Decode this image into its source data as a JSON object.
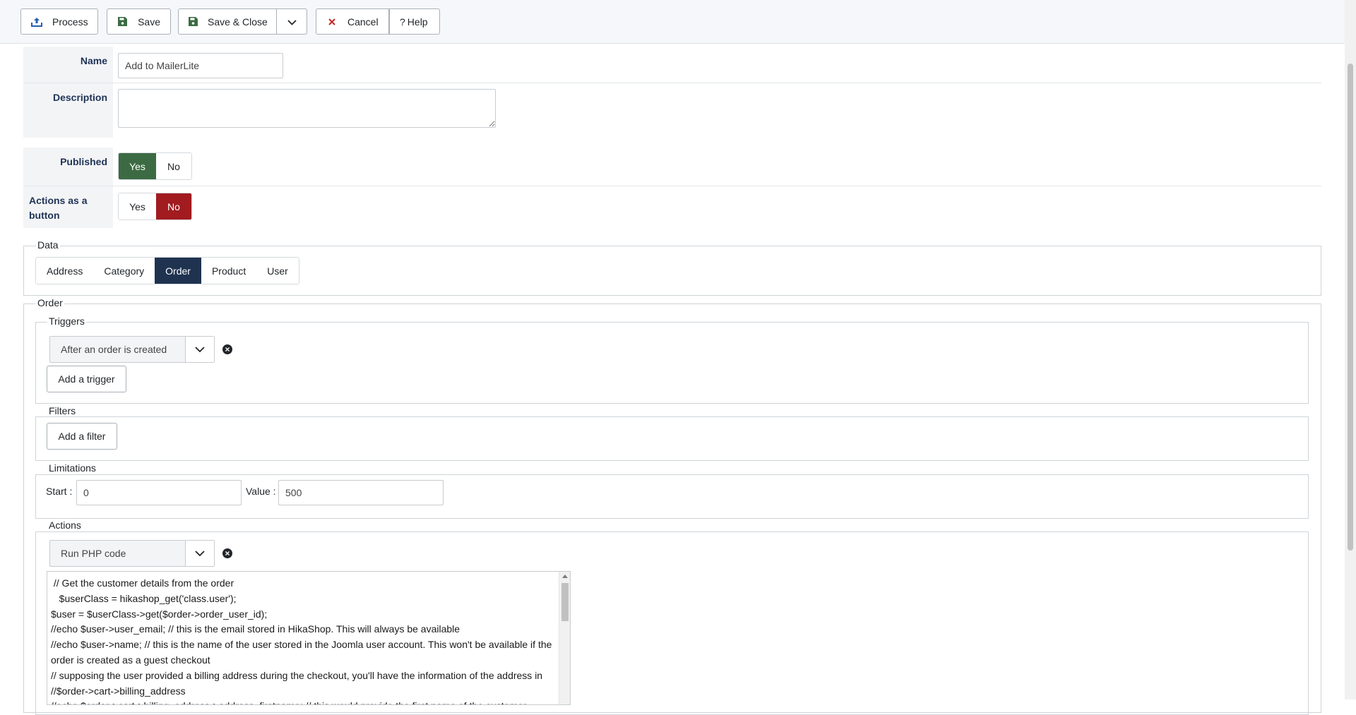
{
  "toolbar": {
    "process": "Process",
    "save": "Save",
    "save_close": "Save & Close",
    "cancel": "Cancel",
    "help": "Help"
  },
  "form": {
    "name_label": "Name",
    "name_value": "Add to MailerLite",
    "description_label": "Description",
    "description_value": "",
    "published_label": "Published",
    "published_value": "Yes",
    "actions_button_label": "Actions as a button",
    "actions_button_value": "No",
    "yes": "Yes",
    "no": "No"
  },
  "data_section": {
    "legend": "Data",
    "tabs": [
      "Address",
      "Category",
      "Order",
      "Product",
      "User"
    ],
    "active_tab": "Order"
  },
  "order": {
    "legend": "Order",
    "triggers": {
      "legend": "Triggers",
      "selected": "After an order is created",
      "add_button": "Add a trigger"
    },
    "filters": {
      "legend": "Filters",
      "add_button": "Add a filter"
    },
    "limitations": {
      "legend": "Limitations",
      "start_label": "Start :",
      "start_value": "0",
      "value_label": "Value :",
      "value_value": "500"
    },
    "actions": {
      "legend": "Actions",
      "selected": "Run PHP code",
      "code_lines": [
        " // Get the customer details from the order",
        "   $userClass = hikashop_get('class.user');",
        "$user = $userClass->get($order->order_user_id);",
        "//echo $user->user_email; // this is the email stored in HikaShop. This will always be available",
        "//echo $user->name; // this is the name of the user stored in the Joomla user account. This won't be available if the order is created as a guest checkout",
        "// supposing the user provided a billing address during the checkout, you'll have the information of the address in //$order->cart->billing_address",
        "//echo $order->cart->billing_address->address_firstname; // this would provide the first name of the customer"
      ]
    }
  },
  "icons": {
    "process": "upload-icon",
    "save": "floppy-disk-icon",
    "cancel": "close-x-icon",
    "help": "question-mark",
    "dropdown": "chevron-down-icon",
    "remove": "remove-circle-icon"
  },
  "colors": {
    "yes_active": "#3c6b43",
    "no_active": "#a11b1f",
    "tab_active": "#1f3350",
    "label_text": "#1f3357"
  }
}
